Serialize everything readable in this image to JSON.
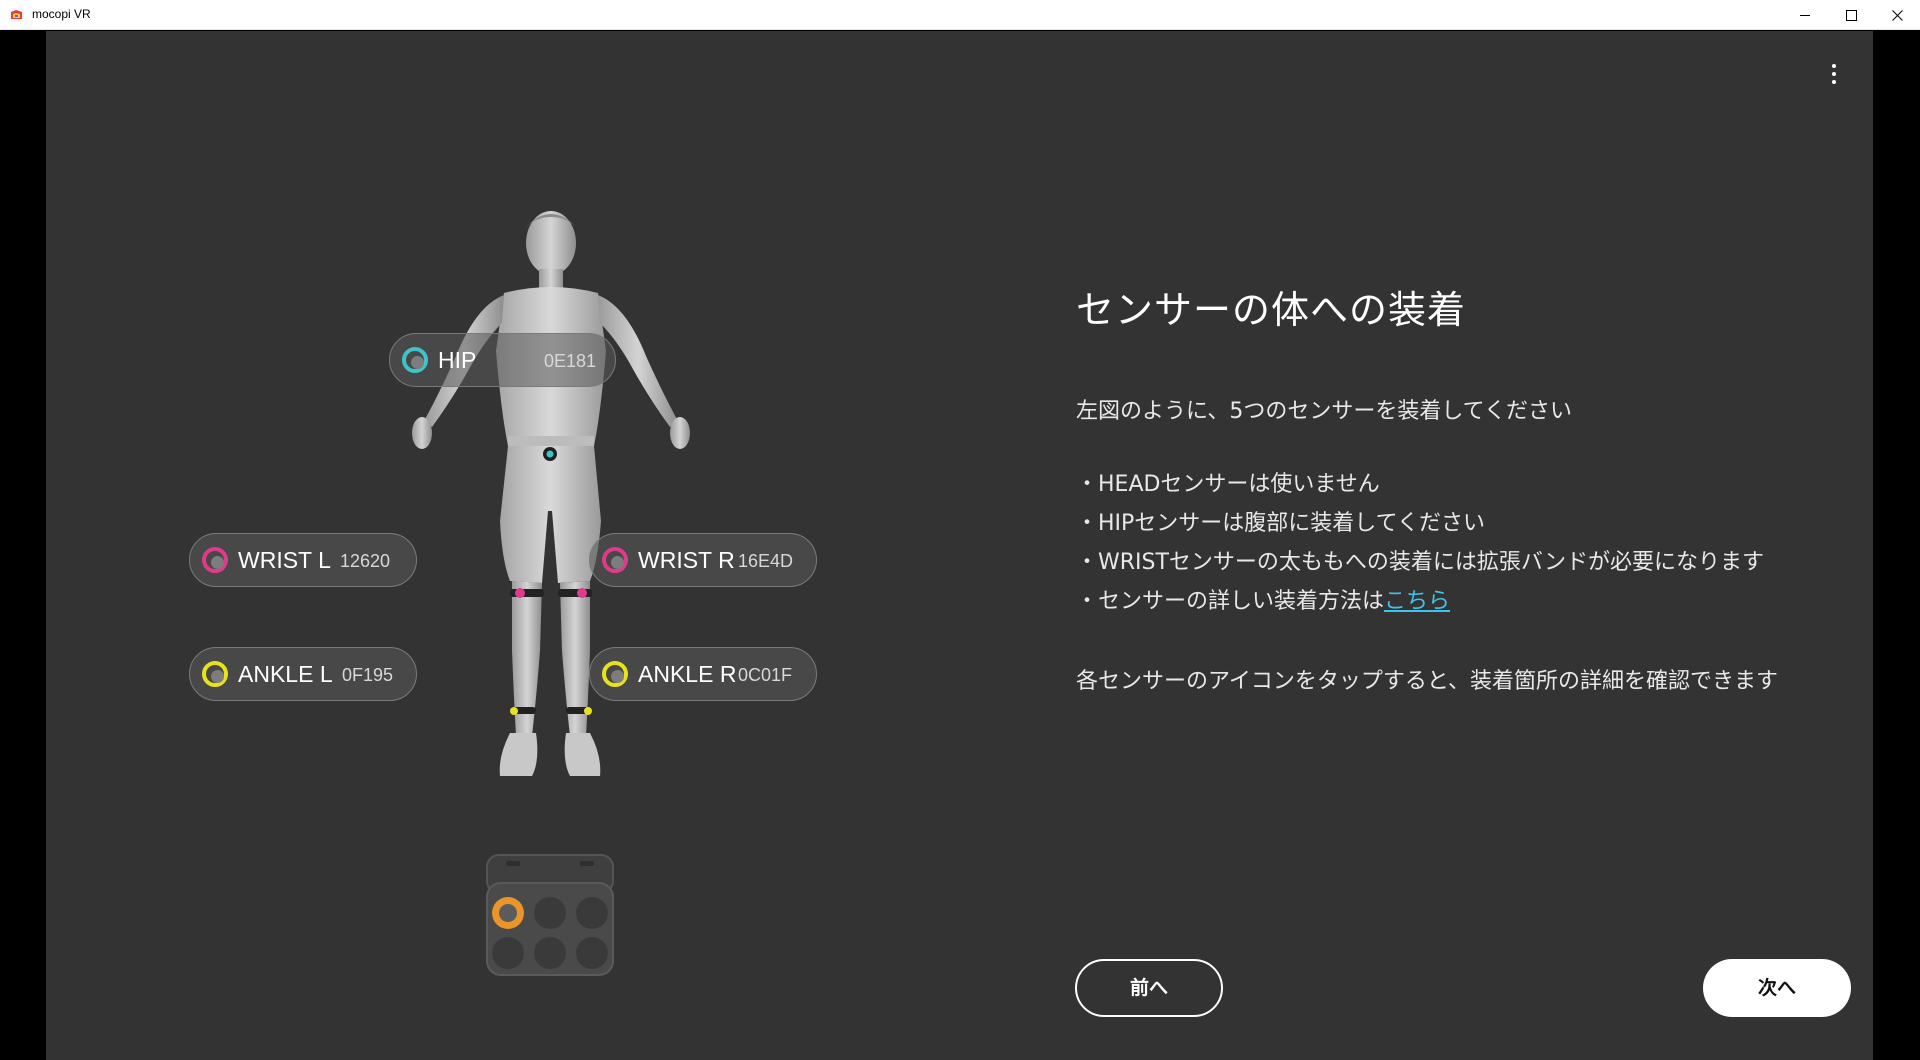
{
  "window": {
    "title": "mocopi VR",
    "icon": "mocopi-app-icon",
    "controls": [
      "minimize-icon",
      "maximize-icon",
      "close-icon"
    ]
  },
  "menu": {
    "icon": "more-vert-icon"
  },
  "sensors": {
    "hip": {
      "label": "HIP",
      "id": "0E181",
      "color": "#3fc3c8"
    },
    "wrist_l": {
      "label": "WRIST L",
      "id": "12620",
      "color": "#e03a8c"
    },
    "wrist_r": {
      "label": "WRIST R",
      "id": "16E4D",
      "color": "#e03a8c"
    },
    "ankle_l": {
      "label": "ANKLE L",
      "id": "0F195",
      "color": "#e6e21e"
    },
    "ankle_r": {
      "label": "ANKLE R",
      "id": "0C01F",
      "color": "#e6e21e"
    }
  },
  "content": {
    "heading": "センサーの体への装着",
    "intro": "左図のように、5つのセンサーを装着してください",
    "bullets": [
      "・HEADセンサーは使いません",
      "・HIPセンサーは腹部に装着してください",
      "・WRISTセンサーの太ももへの装着には拡張バンドが必要になります",
      "・センサーの詳しい装着方法は"
    ],
    "link_text": "こちら",
    "footnote": "各センサーのアイコンをタップすると、装着箇所の詳細を確認できます"
  },
  "buttons": {
    "prev": "前へ",
    "next": "次へ"
  },
  "case": {
    "highlight_color": "#e8952a"
  }
}
